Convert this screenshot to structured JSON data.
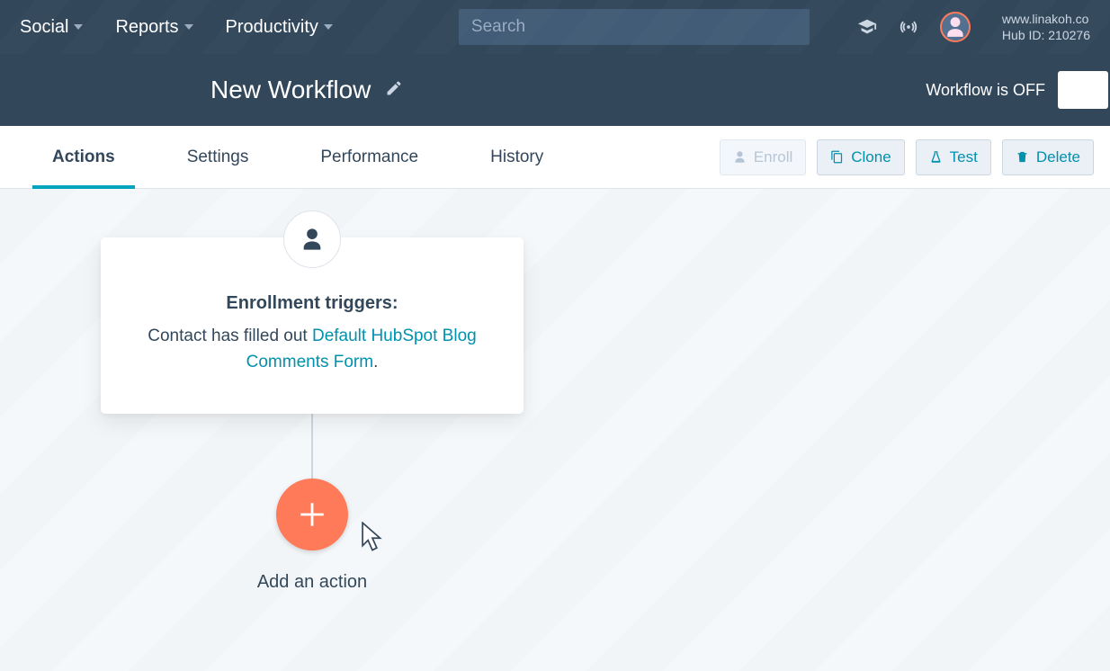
{
  "topnav": {
    "menu": [
      "Social",
      "Reports",
      "Productivity"
    ],
    "search_placeholder": "Search",
    "site": "www.linakoh.co",
    "hubid_label": "Hub ID: 210276"
  },
  "subheader": {
    "title": "New Workflow",
    "status": "Workflow is OFF"
  },
  "tabs": {
    "items": [
      "Actions",
      "Settings",
      "Performance",
      "History"
    ],
    "active": "Actions"
  },
  "buttons": {
    "enroll": "Enroll",
    "clone": "Clone",
    "test": "Test",
    "delete": "Delete"
  },
  "trigger": {
    "title": "Enrollment triggers:",
    "prefix": "Contact has filled out ",
    "link": "Default HubSpot Blog Comments Form",
    "suffix": "."
  },
  "add_action_label": "Add an action"
}
